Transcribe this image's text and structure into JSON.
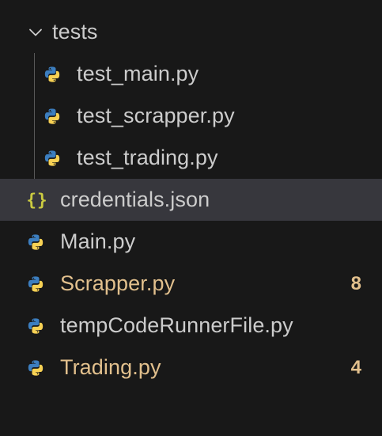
{
  "folder": {
    "name": "tests",
    "icon": "chevron-down-icon",
    "expanded": true,
    "files": [
      {
        "name": "test_main.py",
        "icon": "python-icon"
      },
      {
        "name": "test_scrapper.py",
        "icon": "python-icon"
      },
      {
        "name": "test_trading.py",
        "icon": "python-icon"
      }
    ]
  },
  "root_files": [
    {
      "name": "credentials.json",
      "icon": "json-icon",
      "icon_glyph": "{}",
      "selected": true
    },
    {
      "name": "Main.py",
      "icon": "python-icon"
    },
    {
      "name": "Scrapper.py",
      "icon": "python-icon",
      "badge": "8",
      "modified": true
    },
    {
      "name": "tempCodeRunnerFile.py",
      "icon": "python-icon"
    },
    {
      "name": "Trading.py",
      "icon": "python-icon",
      "badge": "4",
      "modified": true
    }
  ],
  "colors": {
    "background": "#181818",
    "selected_row": "#37373d",
    "text": "#cccccc",
    "modified_text": "#e2c08d",
    "python_blue": "#3c7ebf",
    "python_yellow": "#f7d154",
    "json_icon": "#cbcb41",
    "indent_guide": "#585858"
  }
}
